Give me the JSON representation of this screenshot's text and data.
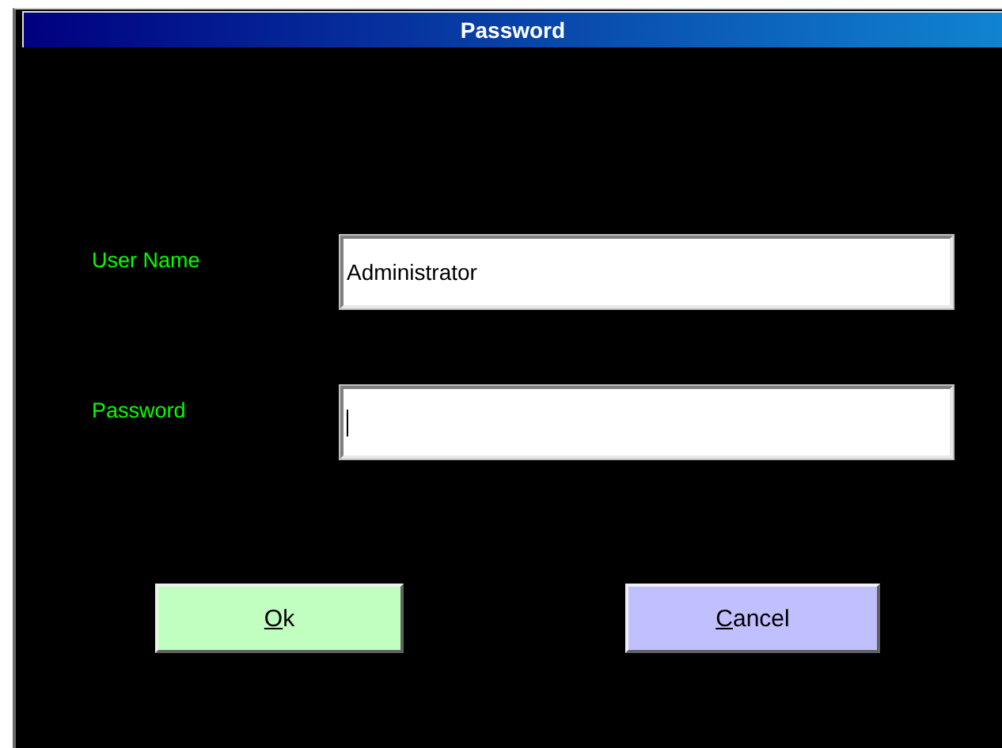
{
  "window": {
    "title": "Password"
  },
  "fields": [
    {
      "label": "User Name",
      "value": "Administrator",
      "focused": false
    },
    {
      "label": "Password",
      "focused": true
    }
  ],
  "buttons": [
    {
      "label": "Ok",
      "mnemonic_underlined": true,
      "kind": "ok"
    },
    {
      "label": "Cancel",
      "mnemonic_underlined": true,
      "kind": "cancel"
    }
  ]
}
